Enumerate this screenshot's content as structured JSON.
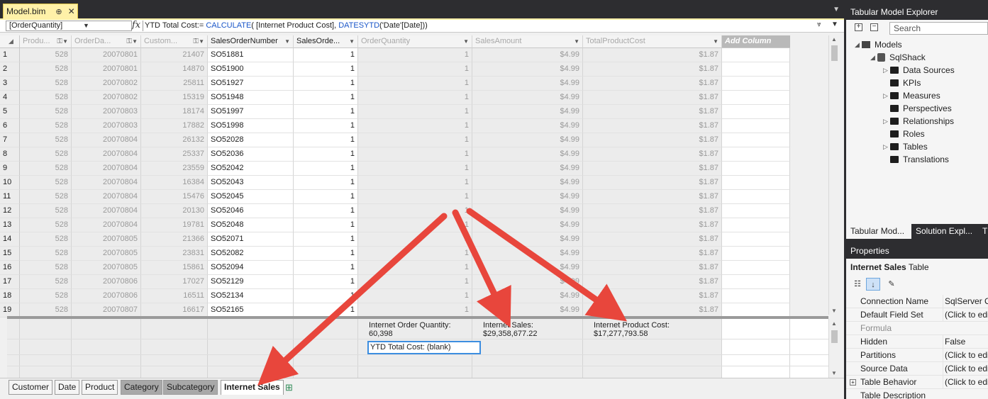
{
  "document": {
    "tab_title": "Model.bim",
    "pin_glyph": "⊕",
    "close_glyph": "✕",
    "overflow_glyph": "▼"
  },
  "formula_bar": {
    "column_selector": "[OrderQuantity]",
    "fx_glyph": "fx",
    "prefix": "YTD Total Cost:= ",
    "fn1": "CALCULATE",
    "mid": "( [Internet Product Cost], ",
    "fn2": "DATESYTD",
    "suffix": "('Date'[Date]))"
  },
  "grid": {
    "corner_glyph": "◢",
    "columns": [
      {
        "label": "Produ...",
        "kind": "gray-num",
        "width": 73,
        "icon": "key"
      },
      {
        "label": "OrderDa...",
        "kind": "gray-num",
        "width": 98,
        "icon": "key"
      },
      {
        "label": "Custom...",
        "kind": "gray-num",
        "width": 94,
        "icon": "key"
      },
      {
        "label": "SalesOrderNumber",
        "kind": "white-text",
        "width": 121,
        "icon": ""
      },
      {
        "label": "SalesOrde...",
        "kind": "white-num",
        "width": 91,
        "icon": ""
      },
      {
        "label": "OrderQuantity",
        "kind": "gray-num",
        "width": 161,
        "icon": ""
      },
      {
        "label": "SalesAmount",
        "kind": "gray-num",
        "width": 156,
        "icon": ""
      },
      {
        "label": "TotalProductCost",
        "kind": "gray-num",
        "width": 196,
        "icon": ""
      },
      {
        "label": "Add Column",
        "kind": "add",
        "width": 96,
        "icon": ""
      }
    ],
    "rows": [
      {
        "n": "1",
        "cells": [
          "528",
          "20070801",
          "21407",
          "SO51881",
          "1",
          "1",
          "$4.99",
          "$1.87"
        ]
      },
      {
        "n": "2",
        "cells": [
          "528",
          "20070801",
          "14870",
          "SO51900",
          "1",
          "1",
          "$4.99",
          "$1.87"
        ]
      },
      {
        "n": "3",
        "cells": [
          "528",
          "20070802",
          "25811",
          "SO51927",
          "1",
          "1",
          "$4.99",
          "$1.87"
        ]
      },
      {
        "n": "4",
        "cells": [
          "528",
          "20070802",
          "15319",
          "SO51948",
          "1",
          "1",
          "$4.99",
          "$1.87"
        ]
      },
      {
        "n": "5",
        "cells": [
          "528",
          "20070803",
          "18174",
          "SO51997",
          "1",
          "1",
          "$4.99",
          "$1.87"
        ]
      },
      {
        "n": "6",
        "cells": [
          "528",
          "20070803",
          "17882",
          "SO51998",
          "1",
          "1",
          "$4.99",
          "$1.87"
        ]
      },
      {
        "n": "7",
        "cells": [
          "528",
          "20070804",
          "26132",
          "SO52028",
          "1",
          "1",
          "$4.99",
          "$1.87"
        ]
      },
      {
        "n": "8",
        "cells": [
          "528",
          "20070804",
          "25337",
          "SO52036",
          "1",
          "1",
          "$4.99",
          "$1.87"
        ]
      },
      {
        "n": "9",
        "cells": [
          "528",
          "20070804",
          "23559",
          "SO52042",
          "1",
          "1",
          "$4.99",
          "$1.87"
        ]
      },
      {
        "n": "10",
        "cells": [
          "528",
          "20070804",
          "16384",
          "SO52043",
          "1",
          "1",
          "$4.99",
          "$1.87"
        ]
      },
      {
        "n": "11",
        "cells": [
          "528",
          "20070804",
          "15476",
          "SO52045",
          "1",
          "1",
          "$4.99",
          "$1.87"
        ]
      },
      {
        "n": "12",
        "cells": [
          "528",
          "20070804",
          "20130",
          "SO52046",
          "1",
          "1",
          "$4.99",
          "$1.87"
        ]
      },
      {
        "n": "13",
        "cells": [
          "528",
          "20070804",
          "19781",
          "SO52048",
          "1",
          "1",
          "$4.99",
          "$1.87"
        ]
      },
      {
        "n": "14",
        "cells": [
          "528",
          "20070805",
          "21366",
          "SO52071",
          "1",
          "1",
          "$4.99",
          "$1.87"
        ]
      },
      {
        "n": "15",
        "cells": [
          "528",
          "20070805",
          "23831",
          "SO52082",
          "1",
          "1",
          "$4.99",
          "$1.87"
        ]
      },
      {
        "n": "16",
        "cells": [
          "528",
          "20070805",
          "15861",
          "SO52094",
          "1",
          "1",
          "$4.99",
          "$1.87"
        ]
      },
      {
        "n": "17",
        "cells": [
          "528",
          "20070806",
          "17027",
          "SO52129",
          "1",
          "1",
          "$4.99",
          "$1.87"
        ]
      },
      {
        "n": "18",
        "cells": [
          "528",
          "20070806",
          "16511",
          "SO52134",
          "1",
          "1",
          "$4.99",
          "$1.87"
        ]
      },
      {
        "n": "19",
        "cells": [
          "528",
          "20070807",
          "16617",
          "SO52165",
          "1",
          "1",
          "$4.99",
          "$1.87"
        ]
      }
    ]
  },
  "measures": {
    "order_qty_label": "Internet Order Quantity:",
    "order_qty_value": "60,398",
    "ytd_total_cost": "YTD Total Cost: (blank)",
    "sales_label": "Internet Sales:",
    "sales_value": "$29,358,677.22",
    "cost_label": "Internet Product Cost:",
    "cost_value": "$17,277,793.58"
  },
  "sheet_tabs": [
    {
      "label": "Customer",
      "style": "normal"
    },
    {
      "label": "Date",
      "style": "normal"
    },
    {
      "label": "Product",
      "style": "normal"
    },
    {
      "label": "Category",
      "style": "dark"
    },
    {
      "label": "Subcategory",
      "style": "dark"
    },
    {
      "label": "Internet Sales",
      "style": "active"
    }
  ],
  "explorer": {
    "title": "Tabular Model Explorer",
    "search_placeholder": "Search",
    "expand_glyph": "+",
    "collapse_glyph": "−",
    "root": "Models",
    "model": "SqlShack",
    "items": [
      {
        "label": "Data Sources",
        "expandable": true
      },
      {
        "label": "KPIs",
        "expandable": false
      },
      {
        "label": "Measures",
        "expandable": true
      },
      {
        "label": "Perspectives",
        "expandable": false
      },
      {
        "label": "Relationships",
        "expandable": true
      },
      {
        "label": "Roles",
        "expandable": false
      },
      {
        "label": "Tables",
        "expandable": true
      },
      {
        "label": "Translations",
        "expandable": false
      }
    ],
    "bottom_tabs": [
      "Tabular Mod...",
      "Solution Expl...",
      "T"
    ]
  },
  "properties": {
    "title": "Properties",
    "object_name": "Internet Sales",
    "object_type": "Table",
    "rows": [
      {
        "name": "Connection Name",
        "value": "SqlServer CE",
        "style": "normal"
      },
      {
        "name": "Default Field Set",
        "value": "(Click to edi",
        "style": "normal"
      },
      {
        "name": "Formula",
        "value": "",
        "style": "sub"
      },
      {
        "name": "Hidden",
        "value": "False",
        "style": "normal"
      },
      {
        "name": "Partitions",
        "value": "(Click to edi",
        "style": "normal"
      },
      {
        "name": "Source Data",
        "value": "(Click to edi",
        "style": "normal"
      },
      {
        "name": "Table Behavior",
        "value": "(Click to edi",
        "style": "expand"
      },
      {
        "name": "Table Description",
        "value": "",
        "style": "normal"
      }
    ]
  },
  "colors": {
    "accent_tab": "#fff1a8",
    "selection_blue": "#3d8ee0",
    "arrow_red": "#e8463c",
    "chrome_dark": "#2d2d30"
  }
}
